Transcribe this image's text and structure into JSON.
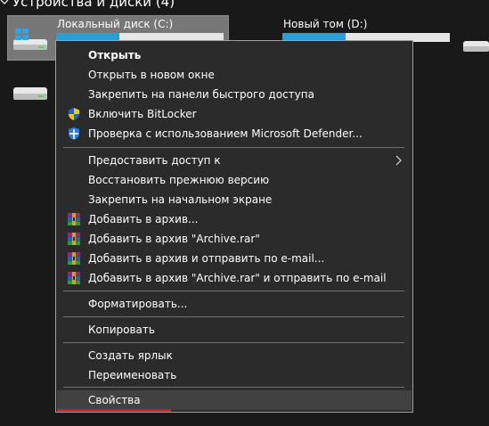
{
  "section": {
    "title": "Устройства и диски (4)"
  },
  "drives": [
    {
      "label": "Локальный диск (C:)",
      "used_fraction": 0.38,
      "selected": true,
      "icon": "windows-drive-icon"
    },
    {
      "label": "Новый том (D:)",
      "used_fraction": 0.38,
      "selected": false,
      "icon": "hdd-icon"
    }
  ],
  "menu": {
    "items": [
      {
        "label": "Открыть",
        "bold": true
      },
      {
        "label": "Открыть в новом окне"
      },
      {
        "label": "Закрепить на панели быстрого доступа"
      },
      {
        "label": "Включить BitLocker",
        "icon": "shield-uac-icon"
      },
      {
        "label": "Проверка с использованием Microsoft Defender...",
        "icon": "defender-icon"
      },
      {
        "label": "Предоставить доступ к",
        "submenu": true
      },
      {
        "label": "Восстановить прежнюю версию"
      },
      {
        "label": "Закрепить на начальном экране"
      },
      {
        "label": "Добавить в архив...",
        "icon": "winrar-icon"
      },
      {
        "label": "Добавить в архив \"Archive.rar\"",
        "icon": "winrar-icon"
      },
      {
        "label": "Добавить в архив и отправить по e-mail...",
        "icon": "winrar-icon"
      },
      {
        "label": "Добавить в архив \"Archive.rar\" и отправить по e-mail",
        "icon": "winrar-icon"
      },
      {
        "label": "Форматировать..."
      },
      {
        "label": "Копировать"
      },
      {
        "label": "Создать ярлык"
      },
      {
        "label": "Переименовать"
      },
      {
        "label": "Свойства",
        "highlighted": true
      }
    ]
  },
  "colors": {
    "accent_fill": "#26a0da",
    "highlight_underline": "#d21f1f",
    "menu_bg": "#2b2b2b"
  }
}
